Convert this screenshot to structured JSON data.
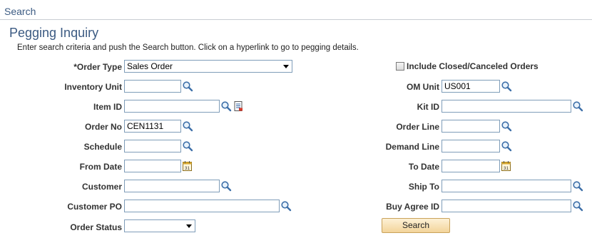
{
  "header": {
    "title": "Search"
  },
  "page": {
    "title": "Pegging Inquiry",
    "instructions": "Enter search criteria and push the Search button. Click on a hyperlink to go to pegging details."
  },
  "form": {
    "order_type": {
      "label": "*Order Type",
      "value": "Sales Order"
    },
    "include_closed": {
      "label": "Include Closed/Canceled Orders",
      "checked": false
    },
    "inventory_unit": {
      "label": "Inventory Unit",
      "value": ""
    },
    "om_unit": {
      "label": "OM Unit",
      "value": "US001"
    },
    "item_id": {
      "label": "Item ID",
      "value": ""
    },
    "kit_id": {
      "label": "Kit ID",
      "value": ""
    },
    "order_no": {
      "label": "Order No",
      "value": "CEN1131"
    },
    "order_line": {
      "label": "Order Line",
      "value": ""
    },
    "schedule": {
      "label": "Schedule",
      "value": ""
    },
    "demand_line": {
      "label": "Demand Line",
      "value": ""
    },
    "from_date": {
      "label": "From Date",
      "value": ""
    },
    "to_date": {
      "label": "To Date",
      "value": ""
    },
    "customer": {
      "label": "Customer",
      "value": ""
    },
    "ship_to": {
      "label": "Ship To",
      "value": ""
    },
    "customer_po": {
      "label": "Customer PO",
      "value": ""
    },
    "buy_agree_id": {
      "label": "Buy Agree ID",
      "value": ""
    },
    "order_status": {
      "label": "Order Status",
      "value": ""
    },
    "search_button": "Search"
  },
  "icons": {
    "lookup": "magnifier-icon",
    "calendar": "calendar-icon",
    "item_detail": "item-detail-icon"
  },
  "colors": {
    "title": "#3b5a82",
    "button": "#f3d49a",
    "input_border": "#7f9db9"
  }
}
